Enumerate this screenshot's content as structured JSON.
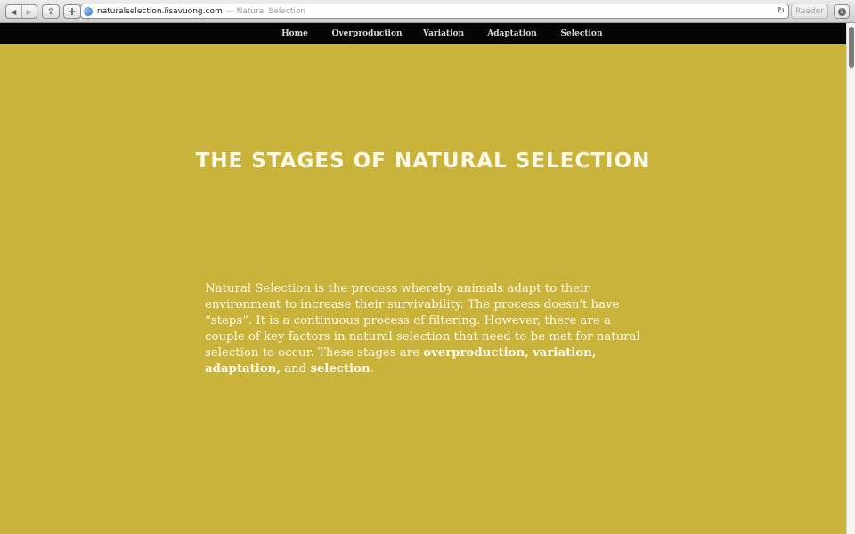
{
  "browser": {
    "back_glyph": "◀",
    "forward_glyph": "▶",
    "share_glyph": "⇪",
    "add_glyph": "+",
    "url": "naturalselection.lisavuong.com",
    "page_title": "— Natural Selection",
    "reload_glyph": "↻",
    "reader_label": "Reader",
    "download_glyph": "↓"
  },
  "nav": {
    "home": "Home",
    "overproduction": "Overproduction",
    "variation": "Variation",
    "adaptation": "Adaptation",
    "selection": "Selection"
  },
  "main": {
    "heading": "THE STAGES OF NATURAL SELECTION",
    "intro_text": "Natural Selection is the process whereby animals adapt to their environment to increase their survivability. The process doesn't have “steps”. It is a continuous process of filtering. However, there are a couple of key factors in natural selection that need to be met for natural selection to occur. These stages are",
    "term_1": "overproduction,",
    "term_2": "variation,",
    "term_3": "adaptation,",
    "conjunction": "and",
    "term_4": "selection",
    "period": "."
  },
  "colors": {
    "page_background": "#c9b33a",
    "nav_background": "#050505",
    "heading_text": "#fbf8ea"
  }
}
